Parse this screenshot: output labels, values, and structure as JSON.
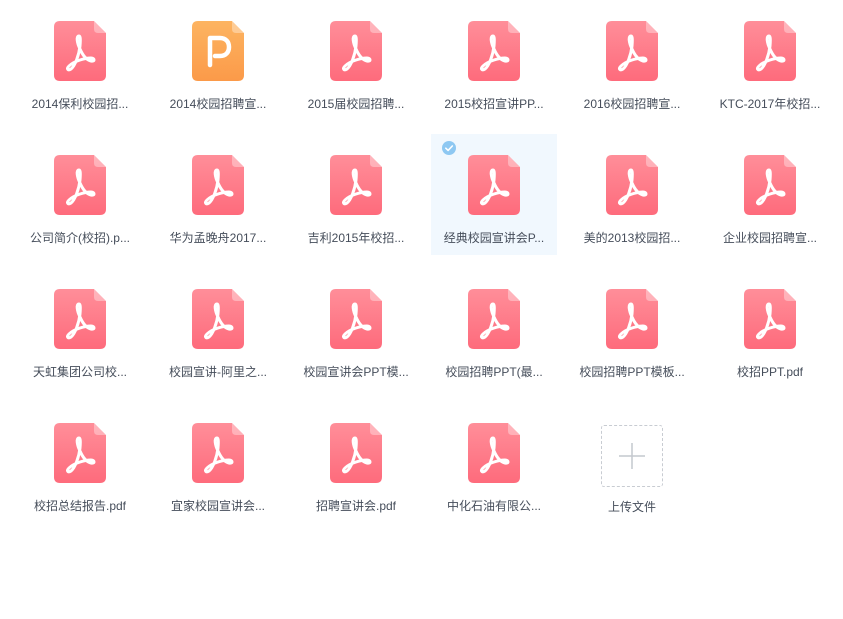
{
  "colors": {
    "pdf_icon_top": "#ff8e99",
    "pdf_icon_bottom": "#fe6b7c",
    "ppt_icon_top": "#fdb461",
    "ppt_icon_bottom": "#fb9a49",
    "selected_bg": "#f1f8fe",
    "check_blue": "#8ec8f2",
    "text": "#454d5a"
  },
  "files": [
    {
      "name": "2014保利校园招...",
      "icon": "pdf-icon",
      "selected": false
    },
    {
      "name": "2014校园招聘宣...",
      "icon": "ppt-icon",
      "selected": false
    },
    {
      "name": "2015届校园招聘...",
      "icon": "pdf-icon",
      "selected": false
    },
    {
      "name": "2015校招宣讲PP...",
      "icon": "pdf-icon",
      "selected": false
    },
    {
      "name": "2016校园招聘宣...",
      "icon": "pdf-icon",
      "selected": false
    },
    {
      "name": "KTC-2017年校招...",
      "icon": "pdf-icon",
      "selected": false
    },
    {
      "name": "公司简介(校招).p...",
      "icon": "pdf-icon",
      "selected": false
    },
    {
      "name": "华为孟晚舟2017...",
      "icon": "pdf-icon",
      "selected": false
    },
    {
      "name": "吉利2015年校招...",
      "icon": "pdf-icon",
      "selected": false
    },
    {
      "name": "经典校园宣讲会P...",
      "icon": "pdf-icon",
      "selected": true
    },
    {
      "name": "美的2013校园招...",
      "icon": "pdf-icon",
      "selected": false
    },
    {
      "name": "企业校园招聘宣...",
      "icon": "pdf-icon",
      "selected": false
    },
    {
      "name": "天虹集团公司校...",
      "icon": "pdf-icon",
      "selected": false
    },
    {
      "name": "校园宣讲-阿里之...",
      "icon": "pdf-icon",
      "selected": false
    },
    {
      "name": "校园宣讲会PPT模...",
      "icon": "pdf-icon",
      "selected": false
    },
    {
      "name": "校园招聘PPT(最...",
      "icon": "pdf-icon",
      "selected": false
    },
    {
      "name": "校园招聘PPT模板...",
      "icon": "pdf-icon",
      "selected": false
    },
    {
      "name": "校招PPT.pdf",
      "icon": "pdf-icon",
      "selected": false
    },
    {
      "name": "校招总结报告.pdf",
      "icon": "pdf-icon",
      "selected": false
    },
    {
      "name": "宜家校园宣讲会...",
      "icon": "pdf-icon",
      "selected": false
    },
    {
      "name": "招聘宣讲会.pdf",
      "icon": "pdf-icon",
      "selected": false
    },
    {
      "name": "中化石油有限公...",
      "icon": "pdf-icon",
      "selected": false
    }
  ],
  "upload": {
    "label": "上传文件",
    "icon": "plus-icon"
  }
}
